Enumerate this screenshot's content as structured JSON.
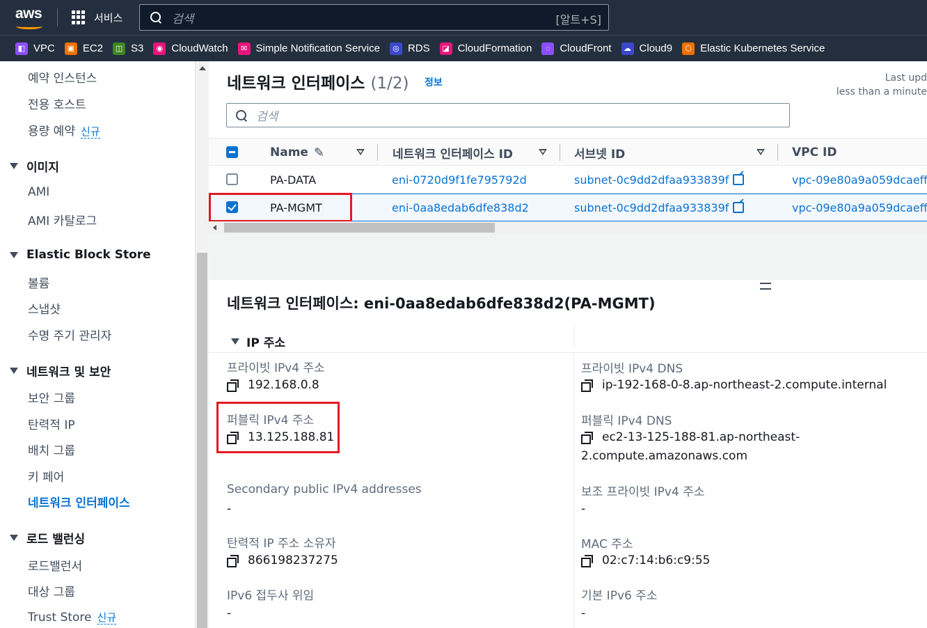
{
  "topnav": {
    "logo": "aws",
    "services_label": "서비스",
    "search_placeholder": "검색",
    "search_shortcut": "[알트+S]"
  },
  "favorites": [
    {
      "label": "VPC",
      "icon": "vpc-icon",
      "color": "#8c4fff"
    },
    {
      "label": "EC2",
      "icon": "ec2-icon",
      "color": "#ed7100"
    },
    {
      "label": "S3",
      "icon": "s3-icon",
      "color": "#3f8624"
    },
    {
      "label": "CloudWatch",
      "icon": "cloudwatch-icon",
      "color": "#e7157b"
    },
    {
      "label": "Simple Notification Service",
      "icon": "sns-icon",
      "color": "#e7157b"
    },
    {
      "label": "RDS",
      "icon": "rds-icon",
      "color": "#3b48cc"
    },
    {
      "label": "CloudFormation",
      "icon": "cloudformation-icon",
      "color": "#e7157b"
    },
    {
      "label": "CloudFront",
      "icon": "cloudfront-icon",
      "color": "#8c4fff"
    },
    {
      "label": "Cloud9",
      "icon": "cloud9-icon",
      "color": "#3b48cc"
    },
    {
      "label": "Elastic Kubernetes Service",
      "icon": "eks-icon",
      "color": "#ed7100"
    }
  ],
  "sidebar": {
    "items_top": [
      "예약 인스턴스",
      "전용 호스트",
      "용량 예약"
    ],
    "new_badge": "신규",
    "sec_images": "이미지",
    "images": [
      "AMI",
      "AMI 카탈로그"
    ],
    "sec_ebs": "Elastic Block Store",
    "ebs": [
      "볼륨",
      "스냅샷",
      "수명 주기 관리자"
    ],
    "sec_net": "네트워크 및 보안",
    "net": [
      "보안 그룹",
      "탄력적 IP",
      "배치 그룹",
      "키 페어",
      "네트워크 인터페이스"
    ],
    "sec_lb": "로드 밸런싱",
    "lb": [
      "로드밸런서",
      "대상 그룹",
      "Trust Store"
    ]
  },
  "main": {
    "title": "네트워크 인터페이스",
    "count": "(1/2)",
    "info": "정보",
    "last_updated_1": "Last upd",
    "last_updated_2": "less than a minute",
    "filter_placeholder": "검색",
    "columns": [
      "Name",
      "네트워크 인터페이스 ID",
      "서브넷 ID",
      "VPC ID"
    ],
    "rows": [
      {
        "name": "PA-DATA",
        "eni": "eni-0720d9f1fe795792d",
        "subnet": "subnet-0c9dd2dfaa933839f",
        "vpc": "vpc-09e80a9a059dcaeff",
        "selected": false
      },
      {
        "name": "PA-MGMT",
        "eni": "eni-0aa8edab6dfe838d2",
        "subnet": "subnet-0c9dd2dfaa933839f",
        "vpc": "vpc-09e80a9a059dcaeff",
        "selected": true
      }
    ]
  },
  "detail": {
    "title": "네트워크 인터페이스: eni-0aa8edab6dfe838d2(PA-MGMT)",
    "section": "IP 주소",
    "private_ipv4_label": "프라이빗 IPv4 주소",
    "private_ipv4": "192.168.0.8",
    "private_dns_label": "프라이빗 IPv4 DNS",
    "private_dns": "ip-192-168-0-8.ap-northeast-2.compute.internal",
    "public_ipv4_label": "퍼블릭 IPv4 주소",
    "public_ipv4": "13.125.188.81",
    "public_dns_label": "퍼블릭 IPv4 DNS",
    "public_dns_1": "ec2-13-125-188-81.ap-northeast-",
    "public_dns_2": "2.compute.amazonaws.com",
    "secondary_public_label": "Secondary public IPv4 addresses",
    "secondary_public": "-",
    "secondary_private_label": "보조 프라이빗 IPv4 주소",
    "secondary_private": "-",
    "eip_owner_label": "탄력적 IP 주소 소유자",
    "eip_owner": "866198237275",
    "mac_label": "MAC 주소",
    "mac": "02:c7:14:b6:c9:55",
    "ipv6_delegation_label": "IPv6 접두사 위임",
    "ipv6_delegation": "-",
    "primary_ipv6_label": "기본 IPv6 주소",
    "primary_ipv6": "-"
  }
}
